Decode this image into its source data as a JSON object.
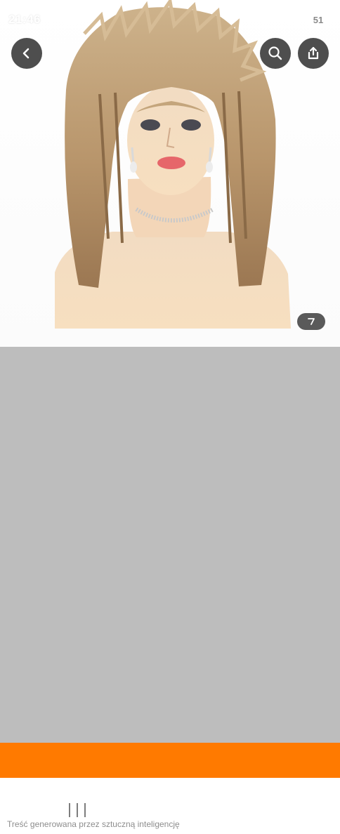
{
  "status_bar": {
    "time": "21:46",
    "battery": "51",
    "icons": [
      "screenshot-icon",
      "youtube-icon",
      "wifi-icon",
      "signal-icon"
    ]
  },
  "top_nav": {
    "icons": [
      "back-arrow-icon",
      "search-icon",
      "share-icon"
    ]
  },
  "product_image": {
    "counter_icon": "gallery-count-icon"
  },
  "colors": {
    "accent": "#ff7a00",
    "panel": "#bdbdbd",
    "button_bg": "#4e4e4e"
  },
  "footer": {
    "ai_note": "Treść generowana przez sztuczną inteligencję"
  }
}
